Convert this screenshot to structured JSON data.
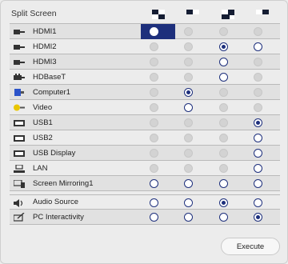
{
  "title": "Split Screen",
  "layout_columns": [
    {
      "name": "layout-1-icon"
    },
    {
      "name": "layout-2-icon"
    },
    {
      "name": "layout-3-icon"
    },
    {
      "name": "layout-4-icon"
    }
  ],
  "rows": [
    {
      "label": "HDMI1",
      "icon": "hdmi-icon",
      "states": [
        "selected-highlight",
        "disabled",
        "disabled",
        "disabled"
      ]
    },
    {
      "label": "HDMI2",
      "icon": "hdmi-icon",
      "states": [
        "disabled",
        "disabled",
        "checked",
        "empty"
      ]
    },
    {
      "label": "HDMI3",
      "icon": "hdmi-icon",
      "states": [
        "disabled",
        "disabled",
        "empty",
        "disabled"
      ]
    },
    {
      "label": "HDBaseT",
      "icon": "hdbaset-icon",
      "states": [
        "disabled",
        "disabled",
        "empty",
        "disabled"
      ]
    },
    {
      "label": "Computer1",
      "icon": "computer-port-icon",
      "states": [
        "disabled",
        "checked",
        "disabled",
        "disabled"
      ]
    },
    {
      "label": "Video",
      "icon": "video-icon",
      "states": [
        "disabled",
        "empty",
        "disabled",
        "disabled"
      ]
    },
    {
      "label": "USB1",
      "icon": "usb-display-icon",
      "states": [
        "disabled",
        "disabled",
        "disabled",
        "checked"
      ]
    },
    {
      "label": "USB2",
      "icon": "usb-display-icon",
      "states": [
        "disabled",
        "disabled",
        "disabled",
        "empty"
      ]
    },
    {
      "label": "USB Display",
      "icon": "usb-display-icon",
      "states": [
        "disabled",
        "disabled",
        "disabled",
        "empty"
      ]
    },
    {
      "label": "LAN",
      "icon": "lan-icon",
      "states": [
        "disabled",
        "disabled",
        "disabled",
        "empty"
      ]
    },
    {
      "label": "Screen Mirroring1",
      "icon": "screen-mirroring-icon",
      "states": [
        "empty",
        "empty",
        "empty",
        "empty"
      ]
    },
    {
      "label": "Audio Source",
      "icon": "speaker-icon",
      "states": [
        "empty",
        "empty",
        "checked",
        "empty"
      ]
    },
    {
      "label": "PC Interactivity",
      "icon": "pen-interactivity-icon",
      "states": [
        "empty",
        "empty",
        "empty",
        "checked"
      ]
    }
  ],
  "execute_label": "Execute",
  "colors": {
    "accent": "#1d2f7c",
    "background": "#ececec",
    "row_alt": "#e1e1e1"
  }
}
